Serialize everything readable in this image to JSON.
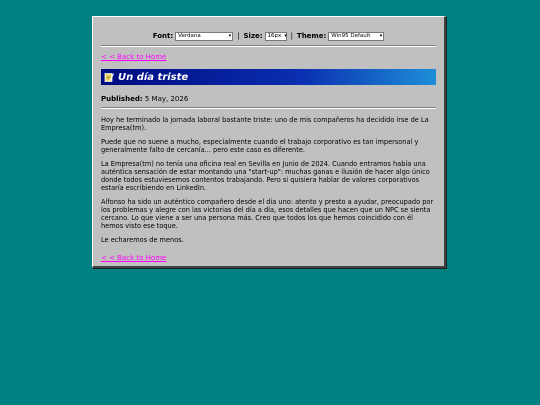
{
  "toolbar": {
    "font_label": "Font:",
    "font_value": "Verdana",
    "size_label": "Size:",
    "size_value": "16px",
    "theme_label": "Theme:",
    "theme_value": "Win95 Default"
  },
  "nav": {
    "back_label": "< < Back to Home"
  },
  "post": {
    "title": "Un día triste",
    "published_label": "Published:",
    "published_date": "5 May, 2026",
    "paragraphs": [
      "Hoy he terminado la jornada laboral bastante triste: uno de mis compañeros ha decidido irse de La Empresa(tm).",
      "Puede que no suene a mucho, especialmente cuando el trabajo corporativo es tan impersonal y generalmente falto de cercanía... pero este caso es diferente.",
      "La Empresa(tm) no tenía una oficina real en Sevilla en Junio de 2024. Cuando entramos había una auténtica sensación de estar montando una \"start-up\": muchas ganas e ilusión de hacer algo único donde todos estuviesemos contentos trabajando. Pero si quisiera hablar de valores corporativos estaría escribiendo en LinkedIn.",
      "Alfonso ha sido un auténtico compañero desde el día uno: atento y presto a ayudar, preocupado por los problemas y alegre con las victorias del día a día, esos detalles que hacen que un NPC se sienta cercano. Lo que viene a ser una persona más. Creo que todos los que hemos coincidido con él hemos visto ese toque.",
      "Le echaremos de menos."
    ]
  }
}
